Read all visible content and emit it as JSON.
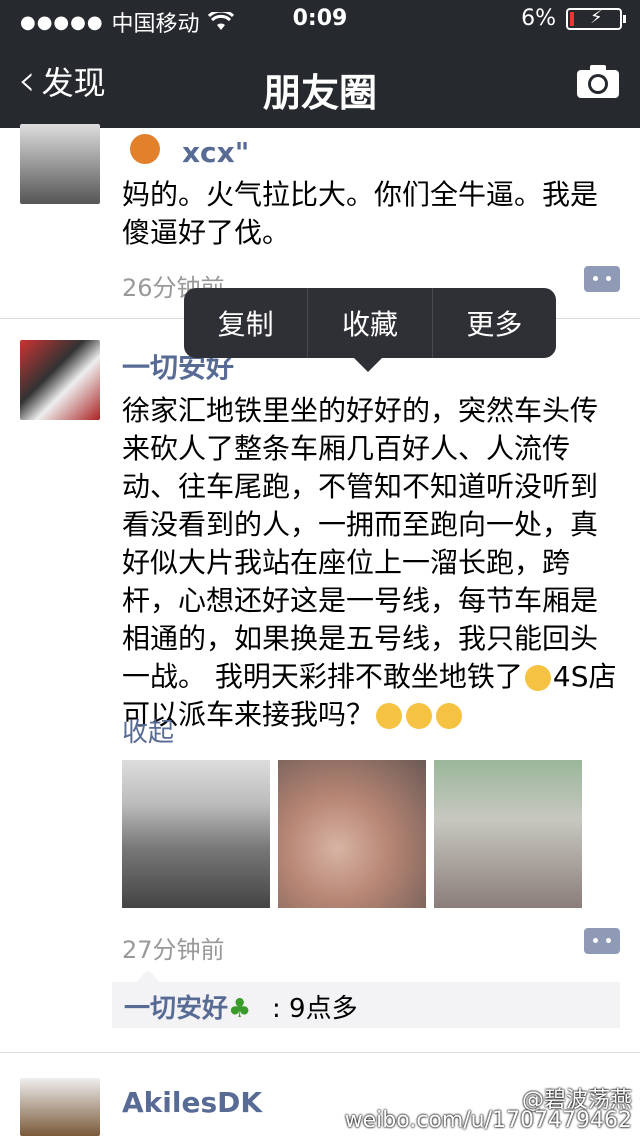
{
  "status_bar": {
    "carrier": "中国移动",
    "time": "0:09",
    "battery": "6%"
  },
  "nav": {
    "back_label": "发现",
    "title": "朋友圈"
  },
  "posts": [
    {
      "name": "xcx\"",
      "text": "妈的。火气拉比大。你们全牛逼。我是傻逼好了伐。",
      "time": "26分钟前"
    },
    {
      "name": "一切安好",
      "text": "徐家汇地铁里坐的好好的，突然车头传来砍人了整条车厢几百好人、人流传动、往车尾跑，不管知不知道听没听到看没看到的人，一拥而至跑向一处，真好似大片我站在座位上一溜长跑，跨杆，心想还好这是一号线，每节车厢是相通的，如果换是五号线，我只能回头一战。 我明天彩排不敢坐地铁了",
      "text_tail": "4S店可以派车来接我吗？",
      "collapse": "收起",
      "time": "27分钟前",
      "comment": {
        "author": "一切安好",
        "text": ": 9点多"
      }
    },
    {
      "name": "AkilesDK"
    }
  ],
  "popup": {
    "copy": "复制",
    "favorite": "收藏",
    "more": "更多"
  },
  "watermark": {
    "handle": "@碧波荡燕",
    "url": "weibo.com/u/1707479462"
  },
  "colors": {
    "nav_bg": "#262a2f",
    "link": "#576b95"
  }
}
